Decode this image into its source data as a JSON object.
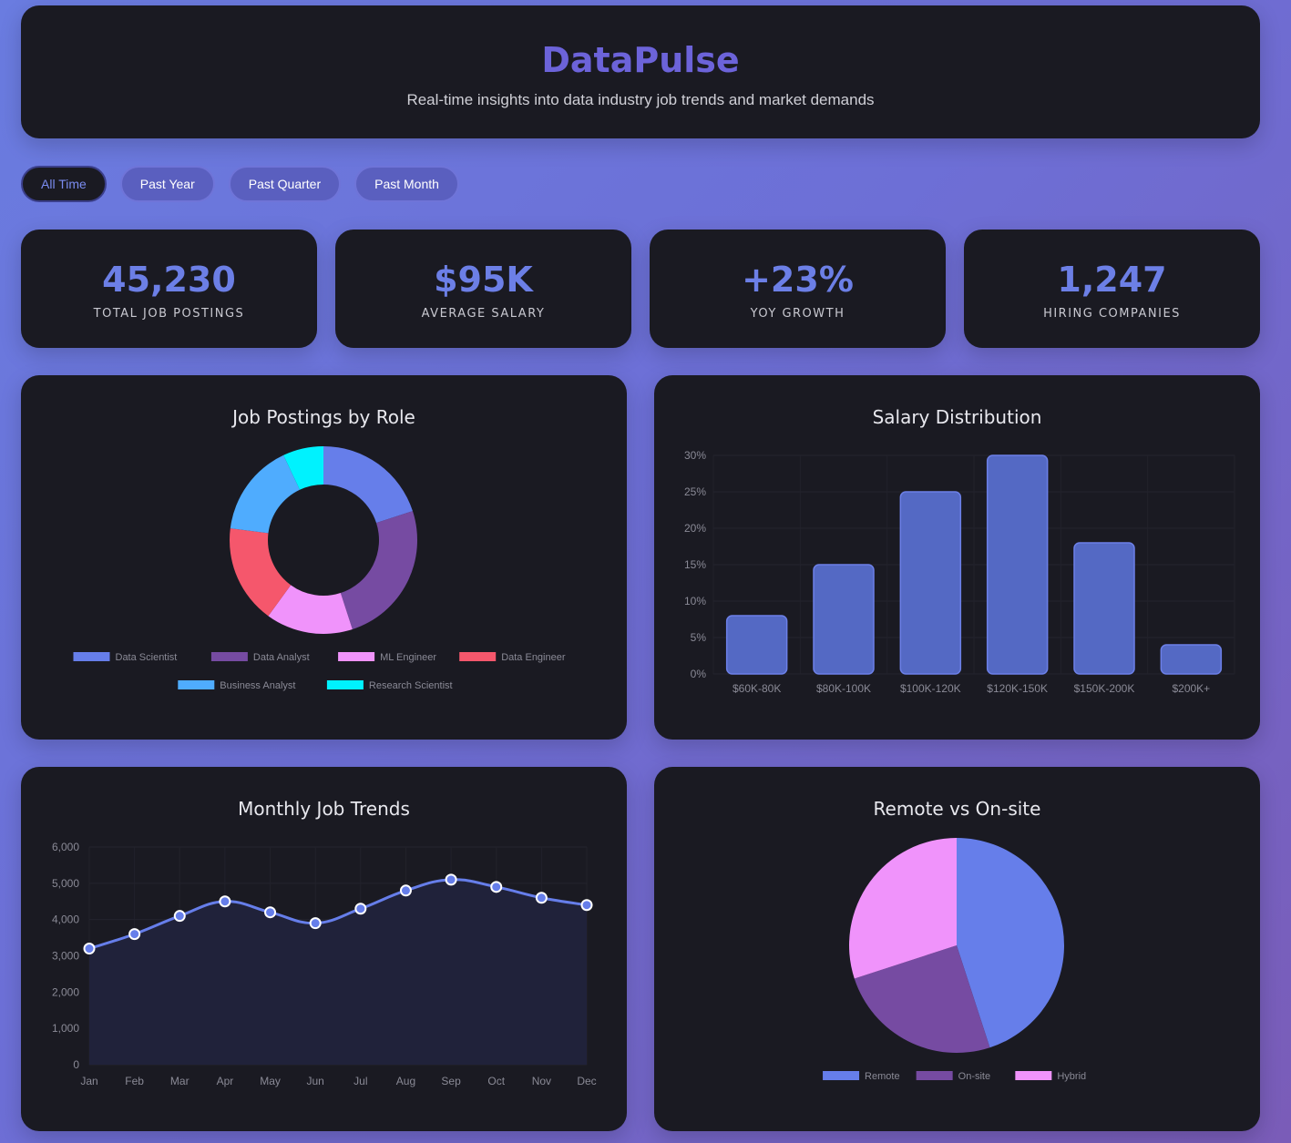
{
  "header": {
    "title": "DataPulse",
    "subtitle": "Real-time insights into data industry job trends and market demands"
  },
  "filters": [
    {
      "label": "All Time",
      "active": true
    },
    {
      "label": "Past Year",
      "active": false
    },
    {
      "label": "Past Quarter",
      "active": false
    },
    {
      "label": "Past Month",
      "active": false
    }
  ],
  "stats": [
    {
      "value": "45,230",
      "label": "TOTAL JOB POSTINGS"
    },
    {
      "value": "$95K",
      "label": "AVERAGE SALARY"
    },
    {
      "value": "+23%",
      "label": "YOY GROWTH"
    },
    {
      "value": "1,247",
      "label": "HIRING COMPANIES"
    }
  ],
  "colors": {
    "accent": "#667eea",
    "purple": "#764ba2",
    "pink": "#f093fb",
    "red": "#f5576c",
    "blue": "#4facfe",
    "cyan": "#00f2fe",
    "bar": "#5469c4"
  },
  "chart_data": [
    {
      "type": "pie",
      "title": "Job Postings by Role",
      "donut": true,
      "categories": [
        "Data Scientist",
        "Data Analyst",
        "ML Engineer",
        "Data Engineer",
        "Business Analyst",
        "Research Scientist"
      ],
      "values": [
        20,
        25,
        15,
        17,
        16,
        7
      ],
      "colors": [
        "#667eea",
        "#764ba2",
        "#f093fb",
        "#f5576c",
        "#4facfe",
        "#00f2fe"
      ],
      "legend": "bottom"
    },
    {
      "type": "bar",
      "title": "Salary Distribution",
      "categories": [
        "$60K-80K",
        "$80K-100K",
        "$100K-120K",
        "$120K-150K",
        "$150K-200K",
        "$200K+"
      ],
      "values": [
        8,
        15,
        25,
        30,
        18,
        4
      ],
      "ylim": [
        0,
        30
      ],
      "yticks": [
        "0%",
        "5%",
        "10%",
        "15%",
        "20%",
        "25%",
        "30%"
      ],
      "grid": true
    },
    {
      "type": "area",
      "title": "Monthly Job Trends",
      "categories": [
        "Jan",
        "Feb",
        "Mar",
        "Apr",
        "May",
        "Jun",
        "Jul",
        "Aug",
        "Sep",
        "Oct",
        "Nov",
        "Dec"
      ],
      "values": [
        3200,
        3600,
        4100,
        4500,
        4200,
        3900,
        4300,
        4800,
        5100,
        4900,
        4600,
        4400
      ],
      "ylim": [
        0,
        6000
      ],
      "yticks": [
        "0",
        "1,000",
        "2,000",
        "3,000",
        "4,000",
        "5,000",
        "6,000"
      ],
      "grid": true
    },
    {
      "type": "pie",
      "title": "Remote vs On-site",
      "categories": [
        "Remote",
        "On-site",
        "Hybrid"
      ],
      "values": [
        45,
        25,
        30
      ],
      "colors": [
        "#667eea",
        "#764ba2",
        "#f093fb"
      ],
      "legend": "bottom"
    }
  ]
}
